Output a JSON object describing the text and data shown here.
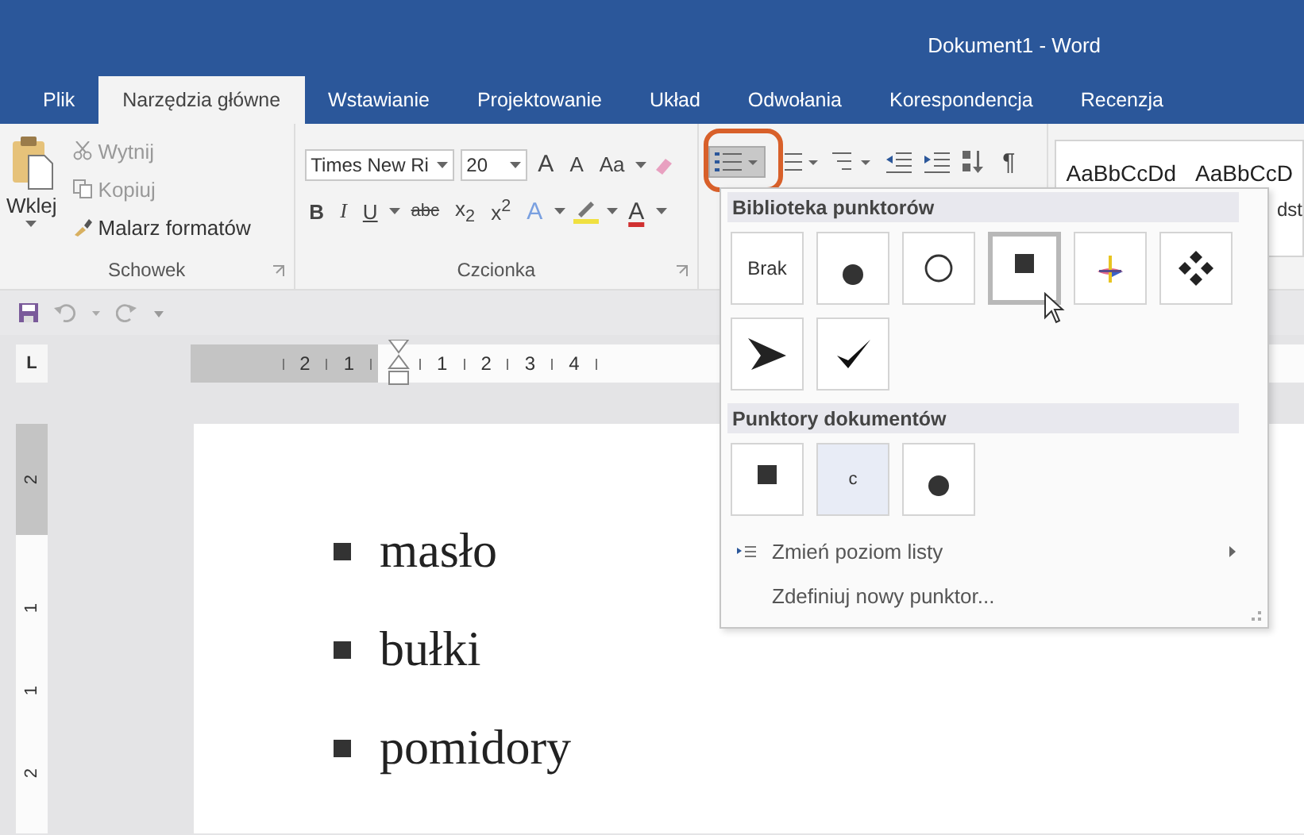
{
  "window": {
    "title": "Dokument1 - Word"
  },
  "tabs": [
    {
      "label": "Plik",
      "selected": false
    },
    {
      "label": "Narzędzia główne",
      "selected": true
    },
    {
      "label": "Wstawianie",
      "selected": false
    },
    {
      "label": "Projektowanie",
      "selected": false
    },
    {
      "label": "Układ",
      "selected": false
    },
    {
      "label": "Odwołania",
      "selected": false
    },
    {
      "label": "Korespondencja",
      "selected": false
    },
    {
      "label": "Recenzja",
      "selected": false
    }
  ],
  "clipboard": {
    "paste": "Wklej",
    "cut": "Wytnij",
    "copy": "Kopiuj",
    "format_painter": "Malarz formatów",
    "group": "Schowek"
  },
  "font": {
    "name": "Times New Ri",
    "size": "20",
    "grow": "A",
    "shrink": "A",
    "change_case": "Aa",
    "bold": "B",
    "italic": "I",
    "underline": "U",
    "strikethrough": "abc",
    "subscript": "x$_{2}$",
    "superscript": "x$^{2}$",
    "effects": "A",
    "color_letter": "A",
    "group": "Czcionka"
  },
  "paragraph": {
    "bullets_active": true,
    "pilcrow": "¶"
  },
  "styles": {
    "samples": [
      "AaBbCcDd",
      "AaBbCcD"
    ],
    "style_label": "dst"
  },
  "ruler": {
    "tab_selector": "L",
    "h_labels": [
      "2",
      "1",
      "1",
      "2",
      "3",
      "4"
    ],
    "v_labels": [
      "2",
      "1",
      "1",
      "2"
    ]
  },
  "document": {
    "items": [
      "masło",
      "bułki",
      "pomidory"
    ]
  },
  "bullet_menu": {
    "library_title": "Biblioteka punktorów",
    "library": [
      {
        "kind": "none",
        "label": "Brak",
        "selected": false
      },
      {
        "kind": "disc",
        "selected": false
      },
      {
        "kind": "circle",
        "selected": false
      },
      {
        "kind": "square",
        "selected": true
      },
      {
        "kind": "picture",
        "selected": false
      },
      {
        "kind": "diamonds",
        "selected": false
      },
      {
        "kind": "arrow",
        "selected": false
      },
      {
        "kind": "check",
        "selected": false
      }
    ],
    "document_title": "Punktory dokumentów",
    "document_bullets": [
      {
        "kind": "square",
        "selected": false
      },
      {
        "kind": "glyph",
        "label": "c",
        "selected": true
      },
      {
        "kind": "disc",
        "selected": false
      }
    ],
    "change_level": "Zmień poziom listy",
    "define_new": "Zdefiniuj nowy punktor..."
  }
}
